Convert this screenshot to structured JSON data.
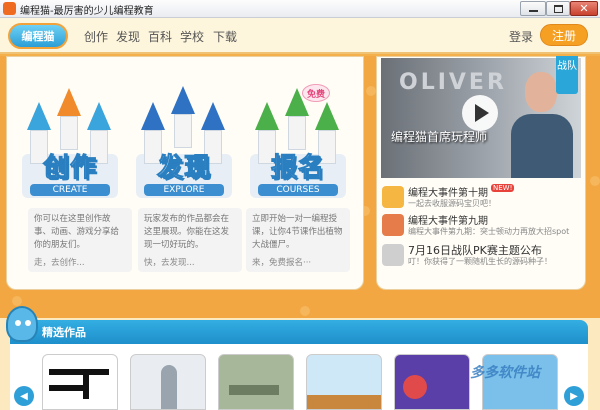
{
  "window": {
    "title": "编程猫-最厉害的少儿编程教育"
  },
  "nav": {
    "logo_text": "编程猫",
    "items": [
      "创作",
      "发现",
      "百科",
      "学校",
      "下载"
    ],
    "login": "登录",
    "register": "注册"
  },
  "features": [
    {
      "label": "创作",
      "sub": "CREATE",
      "desc": "你可以在这里创作故事、动画、游戏分享给你的朋友们。",
      "link": "走，去创作..."
    },
    {
      "label": "发现",
      "sub": "EXPLORE",
      "desc": "玩家发布的作品都会在这里展现。你能在这发现一切好玩的。",
      "link": "快，去发现..."
    },
    {
      "label": "报名",
      "sub": "COURSES",
      "desc": "立即开始一对一编程授课，让你4节课作出植物大战僵尸。",
      "link": "来，免费报名···",
      "badge": "免费"
    }
  ],
  "video": {
    "tag": "战队",
    "word": "OLIVER",
    "overlay": "编程猫首席玩程师"
  },
  "news": [
    {
      "title": "编程大事件第十期",
      "sub": "一起去收服源码宝贝吧！",
      "is_new": true,
      "new_label": "NEW!"
    },
    {
      "title": "编程大事件第九期",
      "sub": "编程大事件第九期：突士顿动力再放大招spot",
      "is_new": false
    },
    {
      "title": "7月16日战队PK赛主题公布",
      "sub": "叮！你获得了一颗随机生长的源码种子！",
      "is_new": false
    }
  ],
  "showcase": {
    "title": "精选作品",
    "prev_icon": "◀",
    "next_icon": "▶"
  },
  "watermark": "多多软件站",
  "colors": {
    "accent": "#f6a023",
    "blue": "#2aa7d8",
    "background": "#f2a742"
  }
}
